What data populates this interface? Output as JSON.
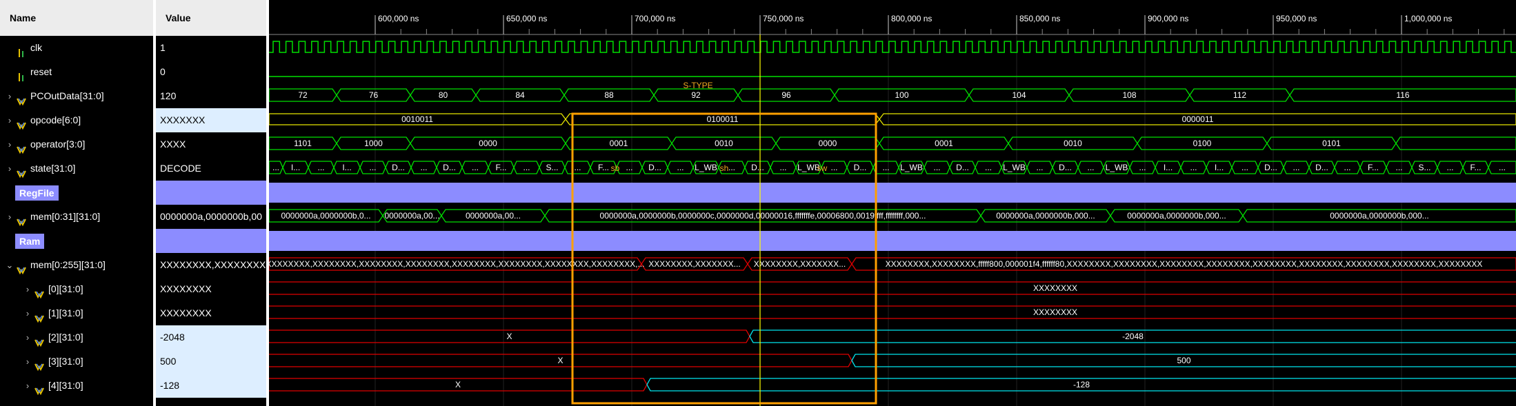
{
  "header": {
    "name_label": "Name",
    "value_label": "Value"
  },
  "signals": [
    {
      "name": "clk",
      "value": "1",
      "icon": "bit-signal-icon",
      "expand": ""
    },
    {
      "name": "reset",
      "value": "0",
      "icon": "bit-signal-icon",
      "expand": ""
    },
    {
      "name": "PCOutData[31:0]",
      "value": "120",
      "icon": "bus-signal-icon",
      "expand": "›"
    },
    {
      "name": "opcode[6:0]",
      "value": "XXXXXXX",
      "icon": "bus-signal-icon",
      "expand": "›"
    },
    {
      "name": "operator[3:0]",
      "value": "XXXX",
      "icon": "bus-signal-icon",
      "expand": "›"
    },
    {
      "name": "state[31:0]",
      "value": "DECODE",
      "icon": "bus-signal-icon",
      "expand": "›"
    },
    {
      "name": "RegFile",
      "value": "",
      "icon": "",
      "expand": ""
    },
    {
      "name": "mem[0:31][31:0]",
      "value": "0000000a,0000000b,00",
      "icon": "bus-signal-icon",
      "expand": "›"
    },
    {
      "name": "Ram",
      "value": "",
      "icon": "",
      "expand": ""
    },
    {
      "name": "mem[0:255][31:0]",
      "value": "XXXXXXXX,XXXXXXXX",
      "icon": "bus-signal-icon",
      "expand": "⌄"
    },
    {
      "name": "[0][31:0]",
      "value": "XXXXXXXX",
      "icon": "bus-signal-icon",
      "expand": "›"
    },
    {
      "name": "[1][31:0]",
      "value": "XXXXXXXX",
      "icon": "bus-signal-icon",
      "expand": "›"
    },
    {
      "name": "[2][31:0]",
      "value": "-2048",
      "icon": "bus-signal-icon",
      "expand": "›"
    },
    {
      "name": "[3][31:0]",
      "value": "500",
      "icon": "bus-signal-icon",
      "expand": "›"
    },
    {
      "name": "[4][31:0]",
      "value": "-128",
      "icon": "bus-signal-icon",
      "expand": "›"
    }
  ],
  "timeline": {
    "ticks": [
      "600,000 ns",
      "650,000 ns",
      "700,000 ns",
      "750,000 ns",
      "800,000 ns",
      "850,000 ns",
      "900,000 ns",
      "950,000 ns",
      "1,000,000 ns"
    ]
  },
  "waves": {
    "pc": [
      "72",
      "76",
      "80",
      "84",
      "88",
      "92",
      "96",
      "100",
      "104",
      "108",
      "112",
      "116"
    ],
    "opcode": [
      "0010011",
      "0100011",
      "0000011"
    ],
    "operator": [
      "1101",
      "1000",
      "0000",
      "0001",
      "0010",
      "0000",
      "0001",
      "0010",
      "0100",
      "0101"
    ],
    "state_fragments": [
      "I...",
      "I...",
      "D...",
      "D...",
      "F...",
      "S...",
      "F...",
      "D...",
      "L_WB",
      "D...",
      "L_WB",
      "D...",
      "L_WB",
      "D...",
      "L_WB",
      "D...",
      "L_WB"
    ],
    "regfile_mem": [
      "0000000a,0000000b,0...",
      "0000000a,00...",
      "0000000a,00...",
      "0000000a,0000000b,0000000c,0000000d,00000016,fffffffe,00006800,0019ffff,ffffffff,000...",
      "0000000a,0000000b,000...",
      "0000000a,0000000b,000...",
      "0000000a,0000000b,000..."
    ],
    "ram_mem": [
      "XXXXXXXX,XXXXXXXX,XXXXXXXX,XXXXXXXX,XXXXXXXX,XXXXXXXX,XXXXXXXX,XXXXXXXX,...",
      "XXXXXXXX,XXXXXXX...",
      "XXXXXXXX,XXXXXXX...",
      "XXXXXXXX,XXXXXXXX,fffff800,000001f4,ffffff80,XXXXXXXX,XXXXXXXX,XXXXXXXX,XXXXXXXX,XXXXXXXX,XXXXXXXX,XXXXXXXX,XXXXXXXX,XXXXXXXX"
    ],
    "mem0": "XXXXXXXX",
    "mem1": "XXXXXXXX",
    "mem2": [
      "X",
      "-2048"
    ],
    "mem3": [
      "X",
      "500"
    ],
    "mem4": [
      "X",
      "-128"
    ]
  },
  "annotations": {
    "title": "S-TYPE",
    "labels": [
      "sb",
      "sh",
      "sw"
    ]
  },
  "colors": {
    "bus": "#00e000",
    "x_state": "#e00000",
    "cursor": "#ffff00",
    "highlight_box": "#ffa000",
    "divider_band": "#8c8cff",
    "defined_mem": "#00e5ee"
  }
}
